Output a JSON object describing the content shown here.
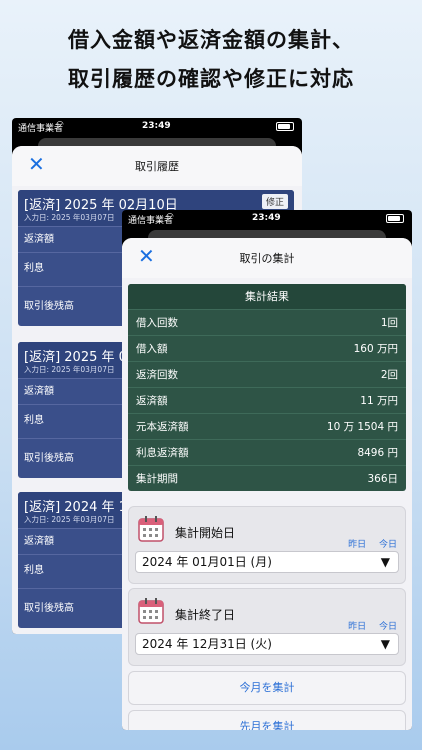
{
  "headline": {
    "line1": "借入金額や返済金額の集計、",
    "line2": "取引履歴の確認や修正に対応"
  },
  "status_bar": {
    "carrier": "通信事業者",
    "time": "23:49"
  },
  "history_screen": {
    "title": "取引履歴",
    "close_icon": "close-icon",
    "transactions": [
      {
        "title": "[返済] 2025 年 02月10日",
        "input_date": "入力日: 2025 年03月07日",
        "edit_label": "修正",
        "rows": [
          "返済額",
          "利息",
          "取引後残高"
        ]
      },
      {
        "title": "[返済] 2025 年 0",
        "input_date": "入力日: 2025 年03月07日",
        "rows": [
          "返済額",
          "利息",
          "取引後残高"
        ]
      },
      {
        "title": "[返済] 2024 年 1",
        "input_date": "入力日: 2025 年03月07日",
        "rows": [
          "返済額",
          "利息",
          "取引後残高"
        ]
      }
    ]
  },
  "summary_screen": {
    "title": "取引の集計",
    "results_header": "集計結果",
    "rows": [
      {
        "label": "借入回数",
        "value": "1回"
      },
      {
        "label": "借入額",
        "value": "160 万円"
      },
      {
        "label": "返済回数",
        "value": "2回"
      },
      {
        "label": "返済額",
        "value": "11 万円"
      },
      {
        "label": "元本返済額",
        "value": "10 万 1504 円"
      },
      {
        "label": "利息返済額",
        "value": "8496 円"
      },
      {
        "label": "集計期間",
        "value": "366日"
      }
    ],
    "start": {
      "label": "集計開始日",
      "yesterday": "昨日",
      "today": "今日",
      "date": "2024 年 01月01日 (月)"
    },
    "end": {
      "label": "集計終了日",
      "yesterday": "昨日",
      "today": "今日",
      "date": "2024 年 12月31日 (火)"
    },
    "buttons": {
      "this_month": "今月を集計",
      "last_month": "先月を集計"
    }
  },
  "colors": {
    "history_card": "#3a4f8a",
    "summary_card": "#2e5446",
    "accent": "#2b6fd6"
  }
}
